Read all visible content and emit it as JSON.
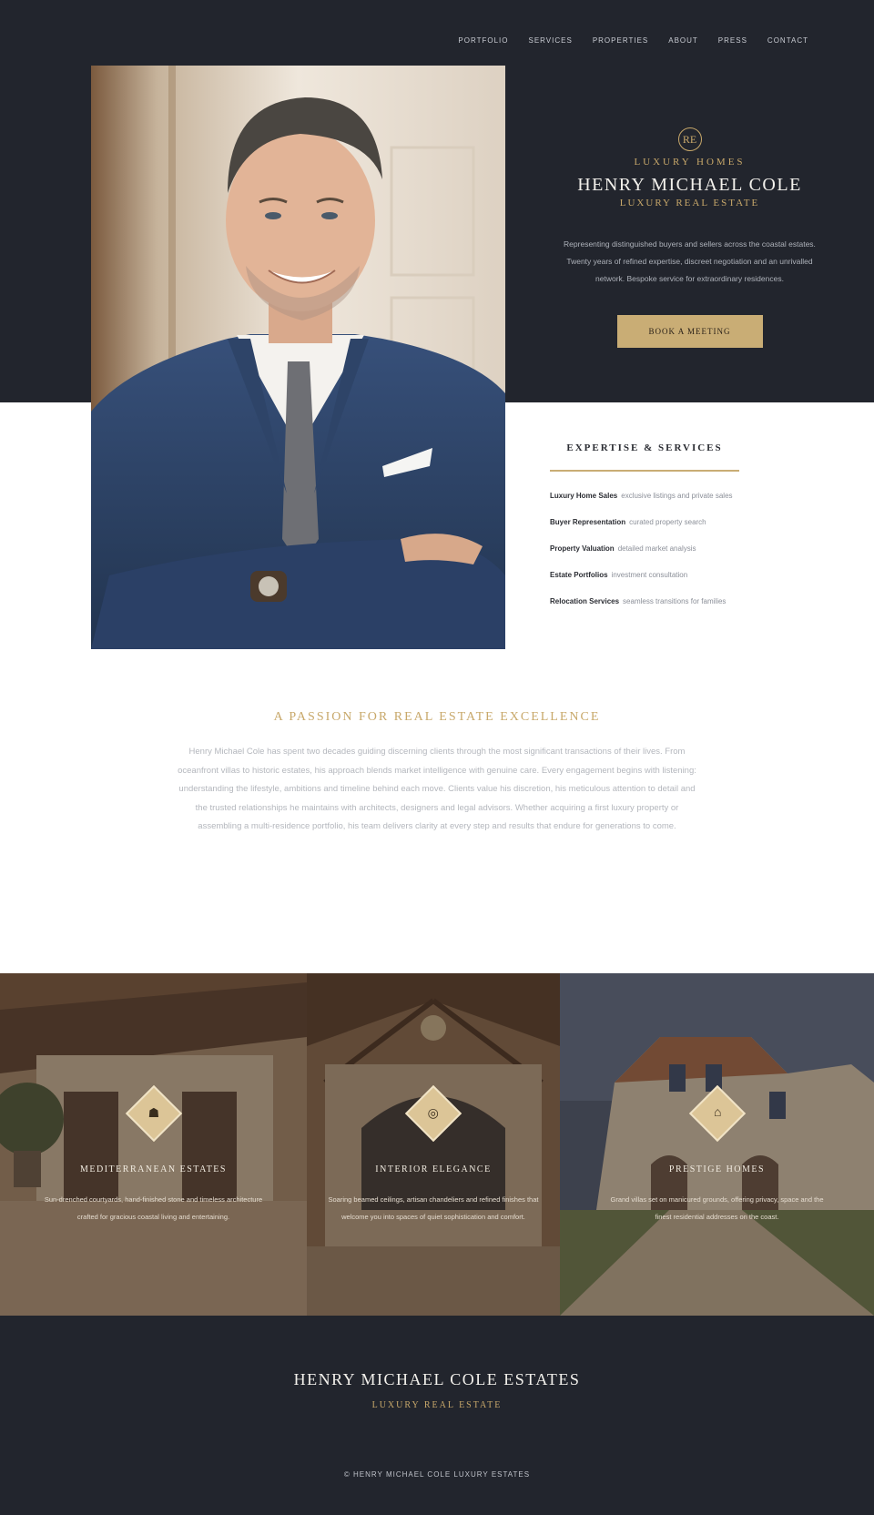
{
  "nav": {
    "items": [
      "PORTFOLIO",
      "SERVICES",
      "PROPERTIES",
      "ABOUT",
      "PRESS",
      "CONTACT"
    ]
  },
  "hero": {
    "emblem": "RE",
    "eyebrow": "LUXURY HOMES",
    "title": "HENRY MICHAEL COLE",
    "subtitle": "LUXURY REAL ESTATE",
    "description": "Representing distinguished buyers and sellers across the coastal estates. Twenty years of refined expertise, discreet negotiation and an unrivalled network. Bespoke service for extraordinary residences.",
    "cta_label": "BOOK A MEETING"
  },
  "services": {
    "title": "EXPERTISE & SERVICES",
    "items": [
      {
        "label": "Luxury Home Sales",
        "detail": "exclusive listings and private sales"
      },
      {
        "label": "Buyer Representation",
        "detail": "curated property search"
      },
      {
        "label": "Property Valuation",
        "detail": "detailed market analysis"
      },
      {
        "label": "Estate Portfolios",
        "detail": "investment consultation"
      },
      {
        "label": "Relocation Services",
        "detail": "seamless transitions for families"
      }
    ]
  },
  "about": {
    "title": "A PASSION FOR REAL ESTATE EXCELLENCE",
    "body": "Henry Michael Cole has spent two decades guiding discerning clients through the most significant transactions of their lives. From oceanfront villas to historic estates, his approach blends market intelligence with genuine care. Every engagement begins with listening: understanding the lifestyle, ambitions and timeline behind each move. Clients value his discretion, his meticulous attention to detail and the trusted relationships he maintains with architects, designers and legal advisors. Whether acquiring a first luxury property or assembling a multi-residence portfolio, his team delivers clarity at every step and results that endure for generations to come."
  },
  "features": [
    {
      "icon": "☗",
      "title": "MEDITERRANEAN ESTATES",
      "text": "Sun-drenched courtyards, hand-finished stone and timeless architecture crafted for gracious coastal living and entertaining."
    },
    {
      "icon": "◎",
      "title": "INTERIOR ELEGANCE",
      "text": "Soaring beamed ceilings, artisan chandeliers and refined finishes that welcome you into spaces of quiet sophistication and comfort."
    },
    {
      "icon": "⌂",
      "title": "PRESTIGE HOMES",
      "text": "Grand villas set on manicured grounds, offering privacy, space and the finest residential addresses on the coast."
    }
  ],
  "footer": {
    "title": "HENRY MICHAEL COLE ESTATES",
    "subtitle": "LUXURY REAL ESTATE",
    "copyright": "© HENRY MICHAEL COLE LUXURY ESTATES"
  },
  "colors": {
    "navy": "#22252d",
    "gold": "#c9ad75",
    "white": "#ffffff"
  }
}
